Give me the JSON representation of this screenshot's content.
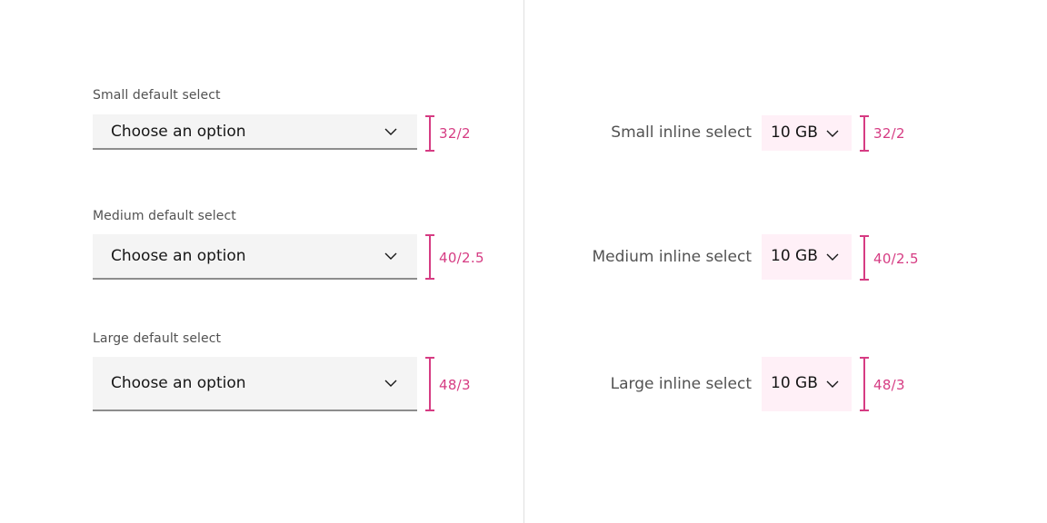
{
  "default_selects": [
    {
      "label": "Small default select",
      "value": "Choose an option",
      "spec": "32/2"
    },
    {
      "label": "Medium default select",
      "value": "Choose an option",
      "spec": "40/2.5"
    },
    {
      "label": "Large default select",
      "value": "Choose an option",
      "spec": "48/3"
    }
  ],
  "inline_selects": [
    {
      "label": "Small inline select",
      "value": "10 GB",
      "spec": "32/2"
    },
    {
      "label": "Medium inline select",
      "value": "10 GB",
      "spec": "40/2.5"
    },
    {
      "label": "Large inline select",
      "value": "10 GB",
      "spec": "48/3"
    }
  ],
  "icons": {
    "dropdown": "chevron-down-icon",
    "spec_marker": "height-spec-marker"
  },
  "colors": {
    "spec_accent": "#d63c83",
    "default_field_bg": "#f4f4f4",
    "inline_field_bg": "#fff0f7",
    "field_border": "#8d8d8d",
    "label_text": "#525252",
    "value_text": "#161616",
    "divider": "#e0e0e0"
  }
}
